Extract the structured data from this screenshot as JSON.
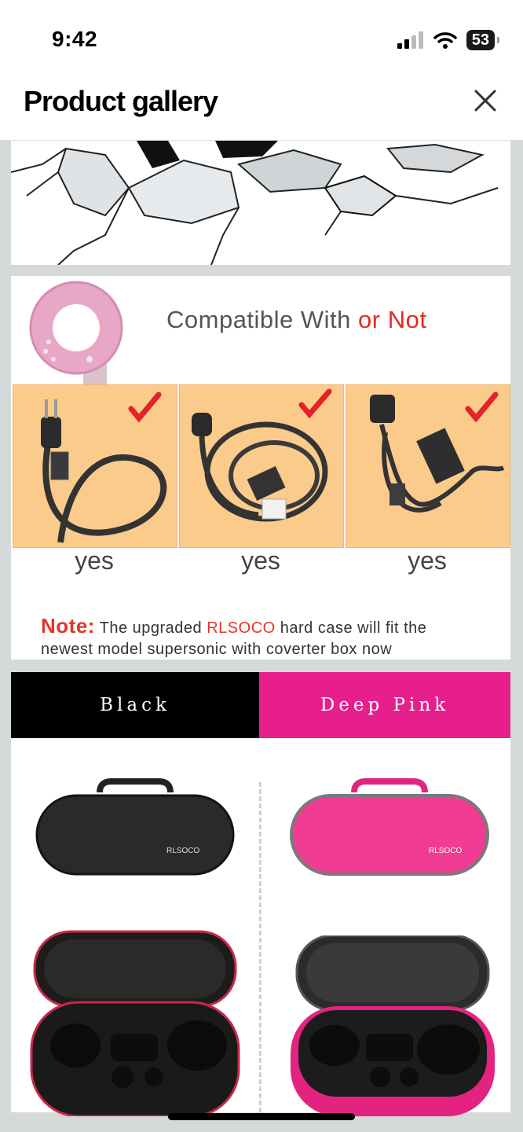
{
  "status_bar": {
    "time": "9:42",
    "battery": "53"
  },
  "header": {
    "title": "Product gallery"
  },
  "compat": {
    "title_main": "Compatible With ",
    "title_accent": "or Not",
    "cards": [
      {
        "label": "yes"
      },
      {
        "label": "yes"
      },
      {
        "label": "yes"
      }
    ],
    "note_label": "Note:",
    "note_pre": " The upgraded ",
    "note_brand": "RLSOCO",
    "note_post": " hard case will fit the",
    "note_line2": "newest model supersonic with coverter box now"
  },
  "colors": {
    "black_label": "Black",
    "pink_label": "Deep Pink",
    "case_logo": "RLSOCO"
  }
}
